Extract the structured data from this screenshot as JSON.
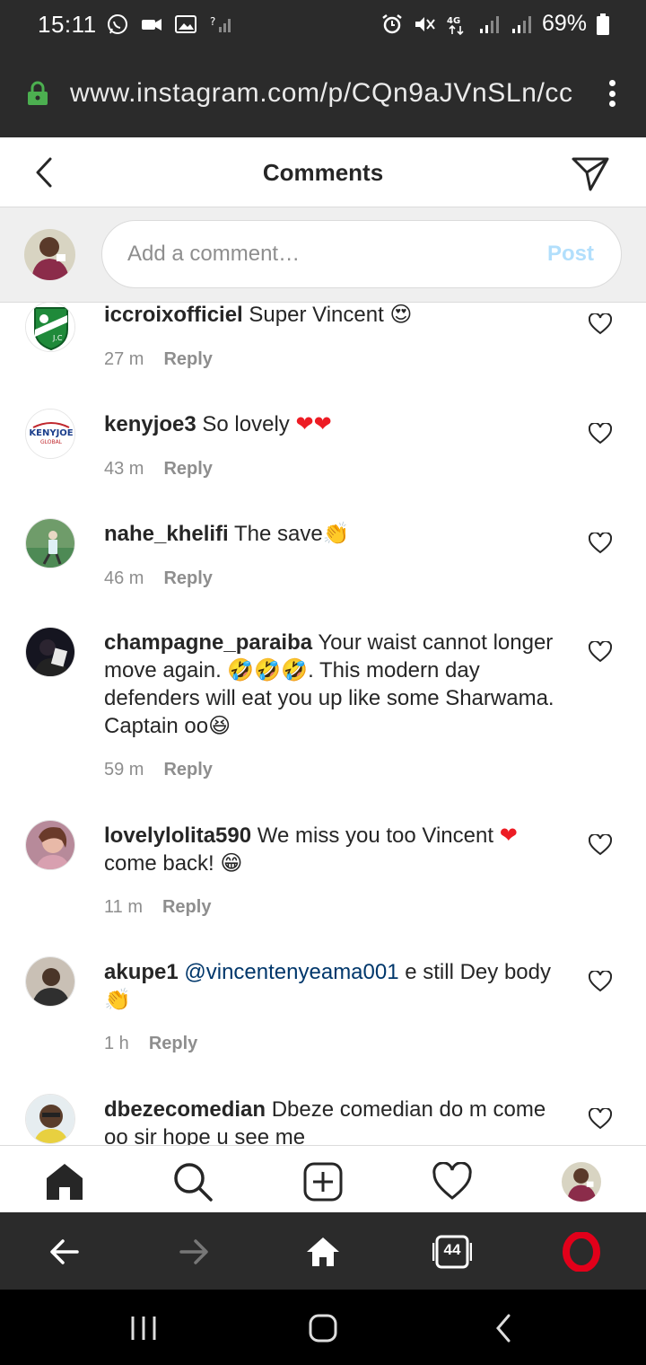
{
  "status_bar": {
    "time": "15:11",
    "battery": "69%",
    "icons": [
      "whatsapp-icon",
      "video-icon",
      "image-icon",
      "no-signal-icon",
      "alarm-icon",
      "mute-icon",
      "4g-icon",
      "signal-icon",
      "signal-icon",
      "battery-icon"
    ]
  },
  "browser": {
    "url": "www.instagram.com/p/CQn9aJVnSLn/cc",
    "tab_count": "44",
    "secure_color": "#4caf50"
  },
  "header": {
    "title": "Comments"
  },
  "composer": {
    "placeholder": "Add a comment…",
    "post_label": "Post"
  },
  "comments": [
    {
      "username": "iccroixofficiel",
      "text": "Super Vincent",
      "emoji": "😍",
      "time": "27 m",
      "reply": "Reply"
    },
    {
      "username": "kenyjoe3",
      "text": "So lovely",
      "emoji": "❤❤",
      "time": "43 m",
      "reply": "Reply"
    },
    {
      "username": "nahe_khelifi",
      "text": "The save",
      "emoji": "👏",
      "time": "46 m",
      "reply": "Reply"
    },
    {
      "username": "champagne_paraiba",
      "text": "Your waist cannot longer move again.",
      "emoji": "🤣🤣🤣",
      "text2": ". This modern day defenders will eat you up like some Sharwama. Captain oo",
      "emoji2": "😆",
      "time": "59 m",
      "reply": "Reply"
    },
    {
      "username": "lovelylolita590",
      "text": "We miss you too Vincent",
      "emoji": "❤",
      "text2": "come back!",
      "emoji2": "😁",
      "time": "11 m",
      "reply": "Reply"
    },
    {
      "username": "akupe1",
      "mention": "@vincentenyeama001",
      "text": "e still Dey body",
      "emoji": "👏",
      "time": "1 h",
      "reply": "Reply"
    },
    {
      "username": "dbezecomedian",
      "text": "Dbeze comedian do m come oo sir hope u see me"
    }
  ],
  "avatars": {
    "kenyjoe_logo": "KENYJOE",
    "kenyjoe_sub": "GLOBAL"
  },
  "colors": {
    "link_blue": "#00376b",
    "post_disabled": "#b2dffc",
    "heart_red": "#ed1c24",
    "opera_red": "#e2001a"
  }
}
